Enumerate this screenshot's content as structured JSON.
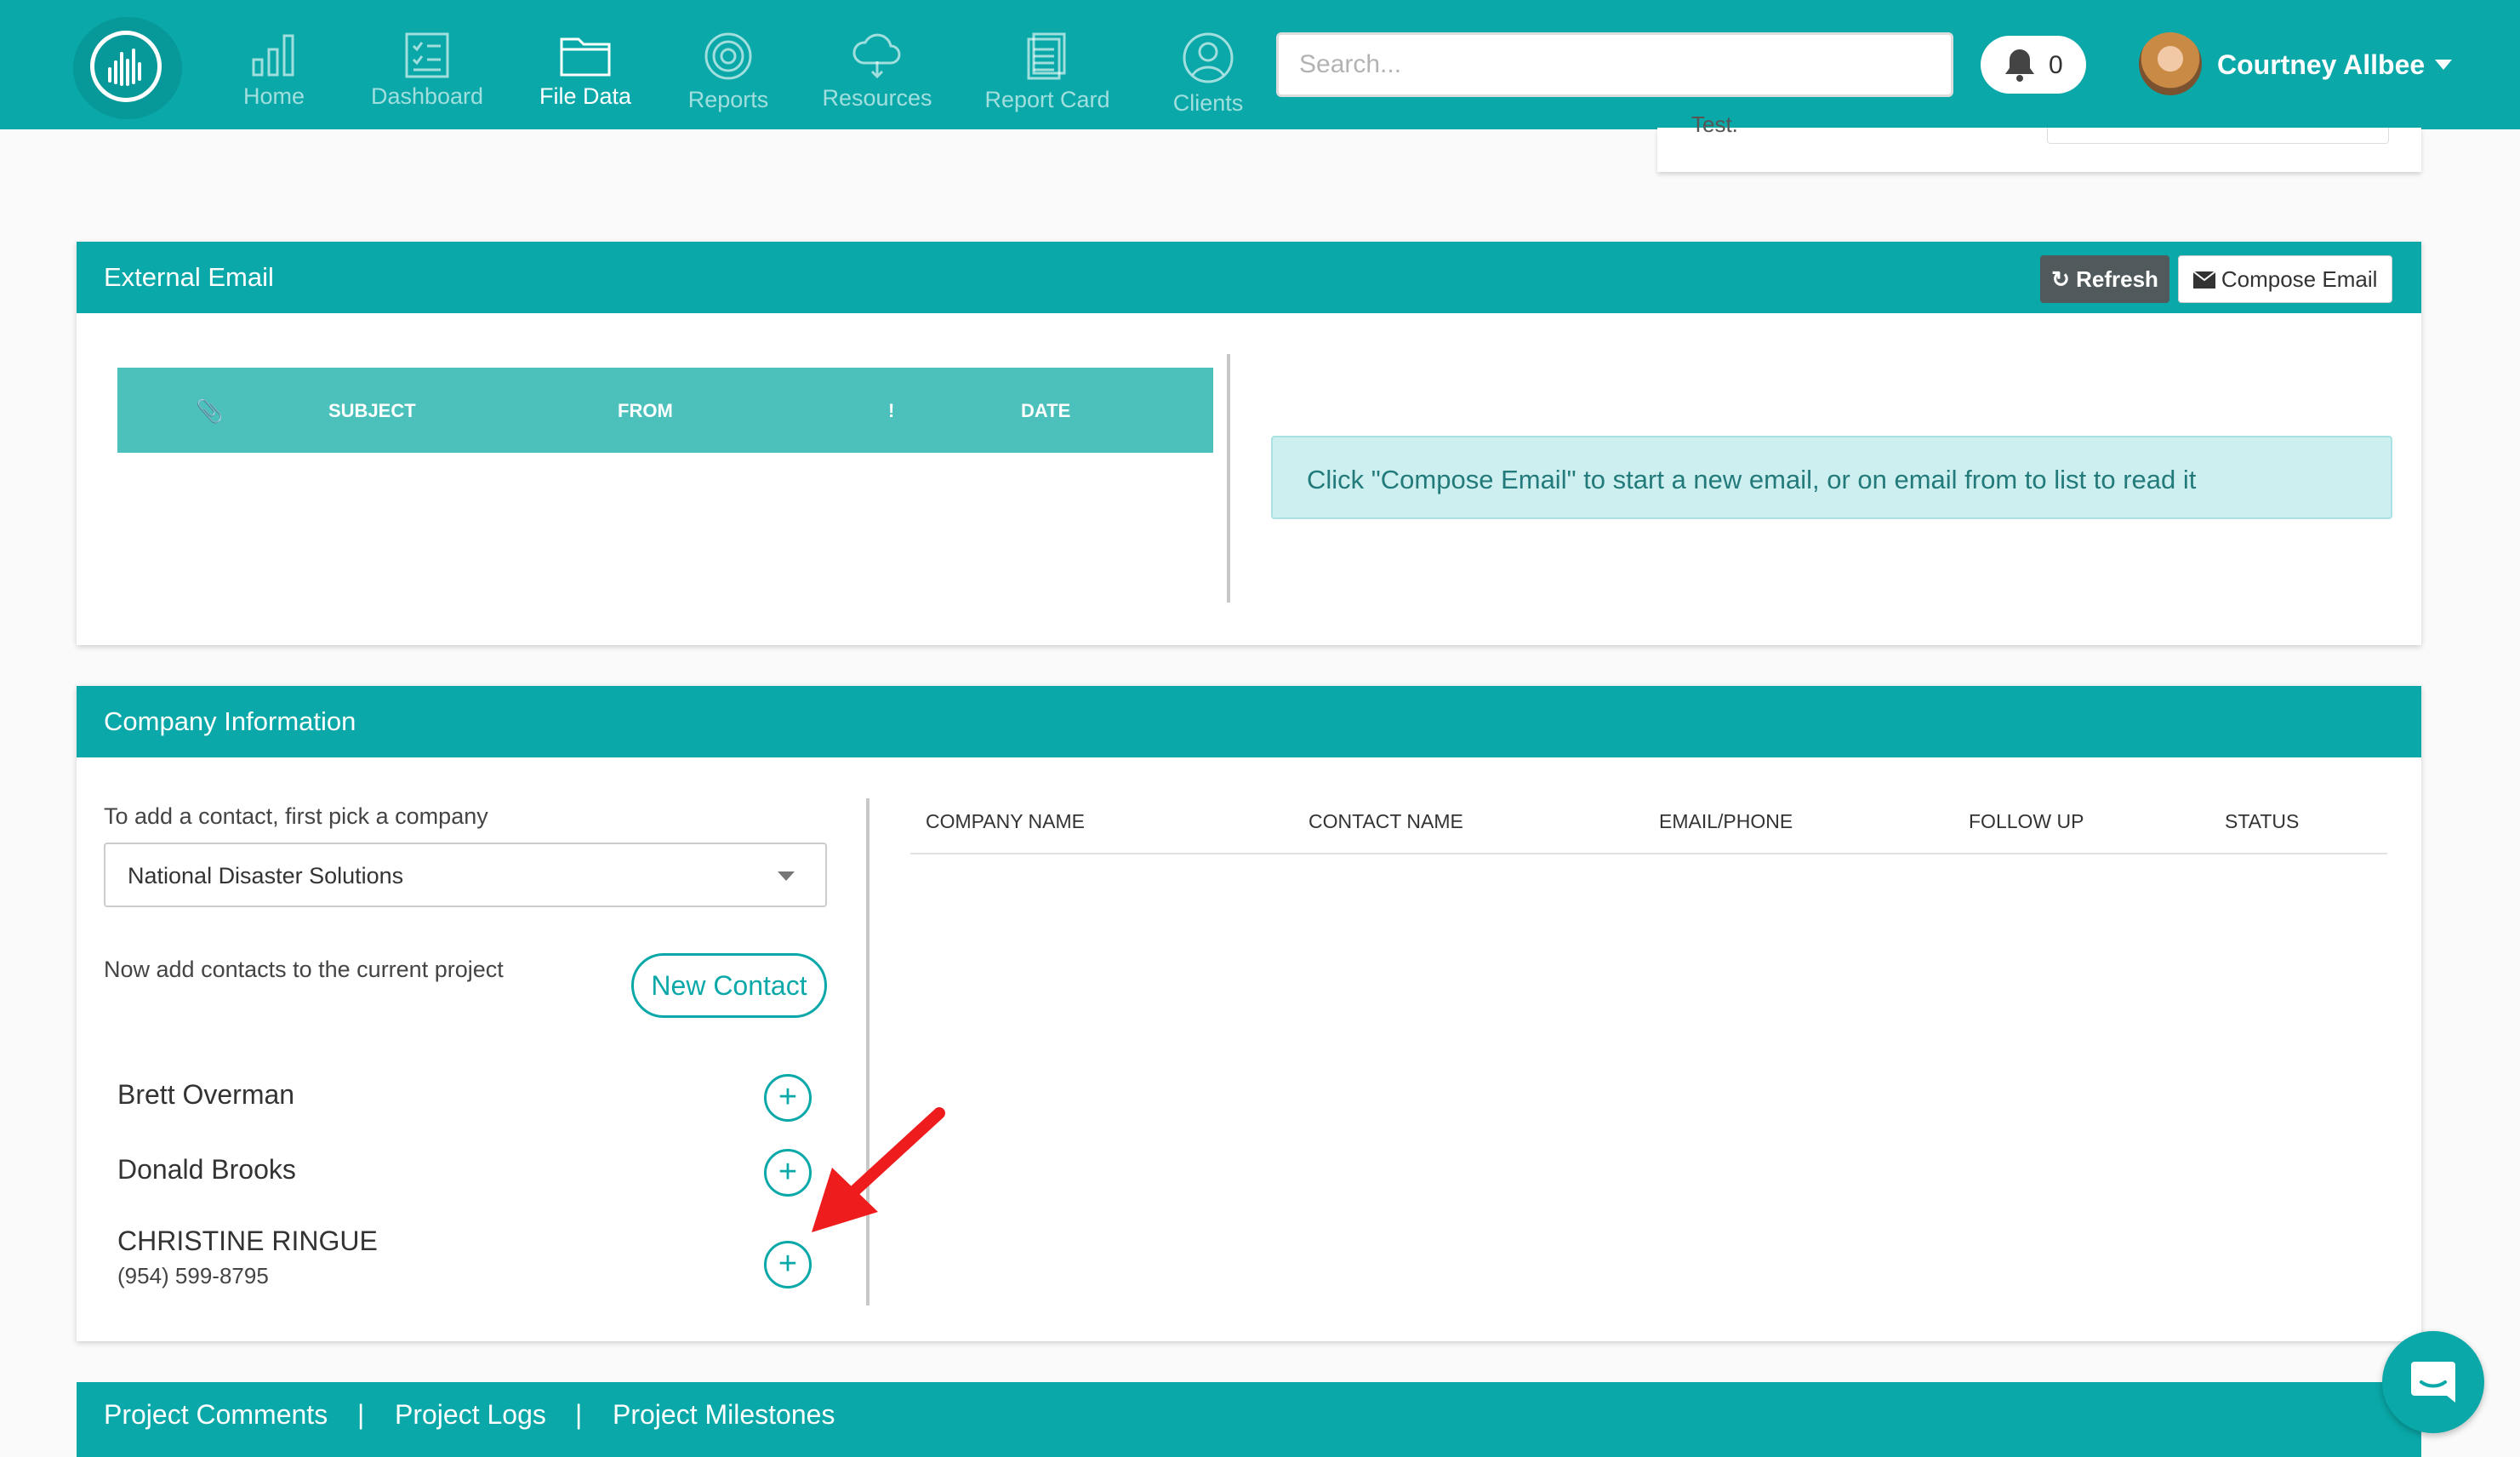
{
  "nav": {
    "items": [
      {
        "label": "Home",
        "icon": "bar-chart-icon"
      },
      {
        "label": "Dashboard",
        "icon": "checklist-icon"
      },
      {
        "label": "File Data",
        "icon": "folder-icon"
      },
      {
        "label": "Reports",
        "icon": "target-icon"
      },
      {
        "label": "Resources",
        "icon": "cloud-icon"
      },
      {
        "label": "Report Card",
        "icon": "document-icon"
      },
      {
        "label": "Clients",
        "icon": "user-circle-icon"
      }
    ],
    "active": "File Data",
    "search_placeholder": "Search...",
    "notification_count": "0",
    "user_name": "Courtney Allbee"
  },
  "top_fragment": {
    "label": "Test."
  },
  "external_email": {
    "title": "External Email",
    "refresh_label": "Refresh",
    "compose_label": "Compose Email",
    "columns": [
      "SUBJECT",
      "FROM",
      "!",
      "DATE"
    ],
    "attachment_icon": "paperclip-icon",
    "info_message": "Click \"Compose Email\" to start a new email, or on email from to list to read it"
  },
  "company_info": {
    "title": "Company Information",
    "pick_label": "To add a contact, first pick a company",
    "selected_company": "National Disaster Solutions",
    "add_contacts_label": "Now add contacts to the current project",
    "new_contact_label": "New Contact",
    "contacts": [
      {
        "name": "Brett Overman",
        "phone": ""
      },
      {
        "name": "Donald Brooks",
        "phone": ""
      },
      {
        "name": "CHRISTINE RINGUE",
        "phone": "(954) 599-8795"
      }
    ],
    "columns": [
      "COMPANY NAME",
      "CONTACT NAME",
      "EMAIL/PHONE",
      "FOLLOW UP",
      "STATUS"
    ]
  },
  "bottom_tabs": {
    "items": [
      "Project Comments",
      "Project Logs",
      "Project Milestones"
    ],
    "separator": "|"
  },
  "colors": {
    "primary": "#0aa8a8",
    "info_bg": "#cdeff0",
    "annotation_arrow": "#ee1c1c"
  }
}
